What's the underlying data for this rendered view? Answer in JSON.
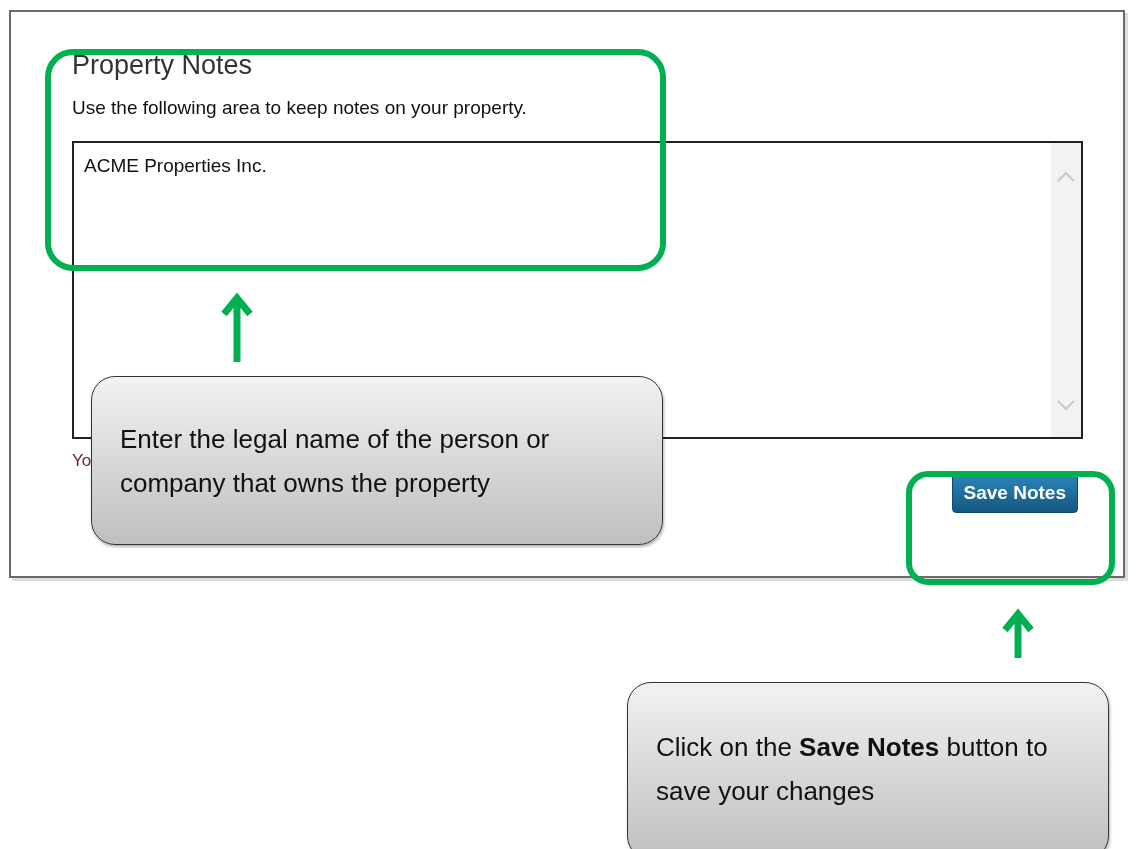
{
  "panel": {
    "title": "Property Notes",
    "description": "Use the following area to keep notes on your property.",
    "notes_field": {
      "value": "ACME Properties Inc."
    },
    "footnote": "Yo",
    "save_button": "Save Notes"
  },
  "callouts": [
    {
      "text": "Enter the legal name of the person or company that owns the property"
    },
    {
      "text": "Click on the **Save Notes** button to save your changes"
    }
  ]
}
